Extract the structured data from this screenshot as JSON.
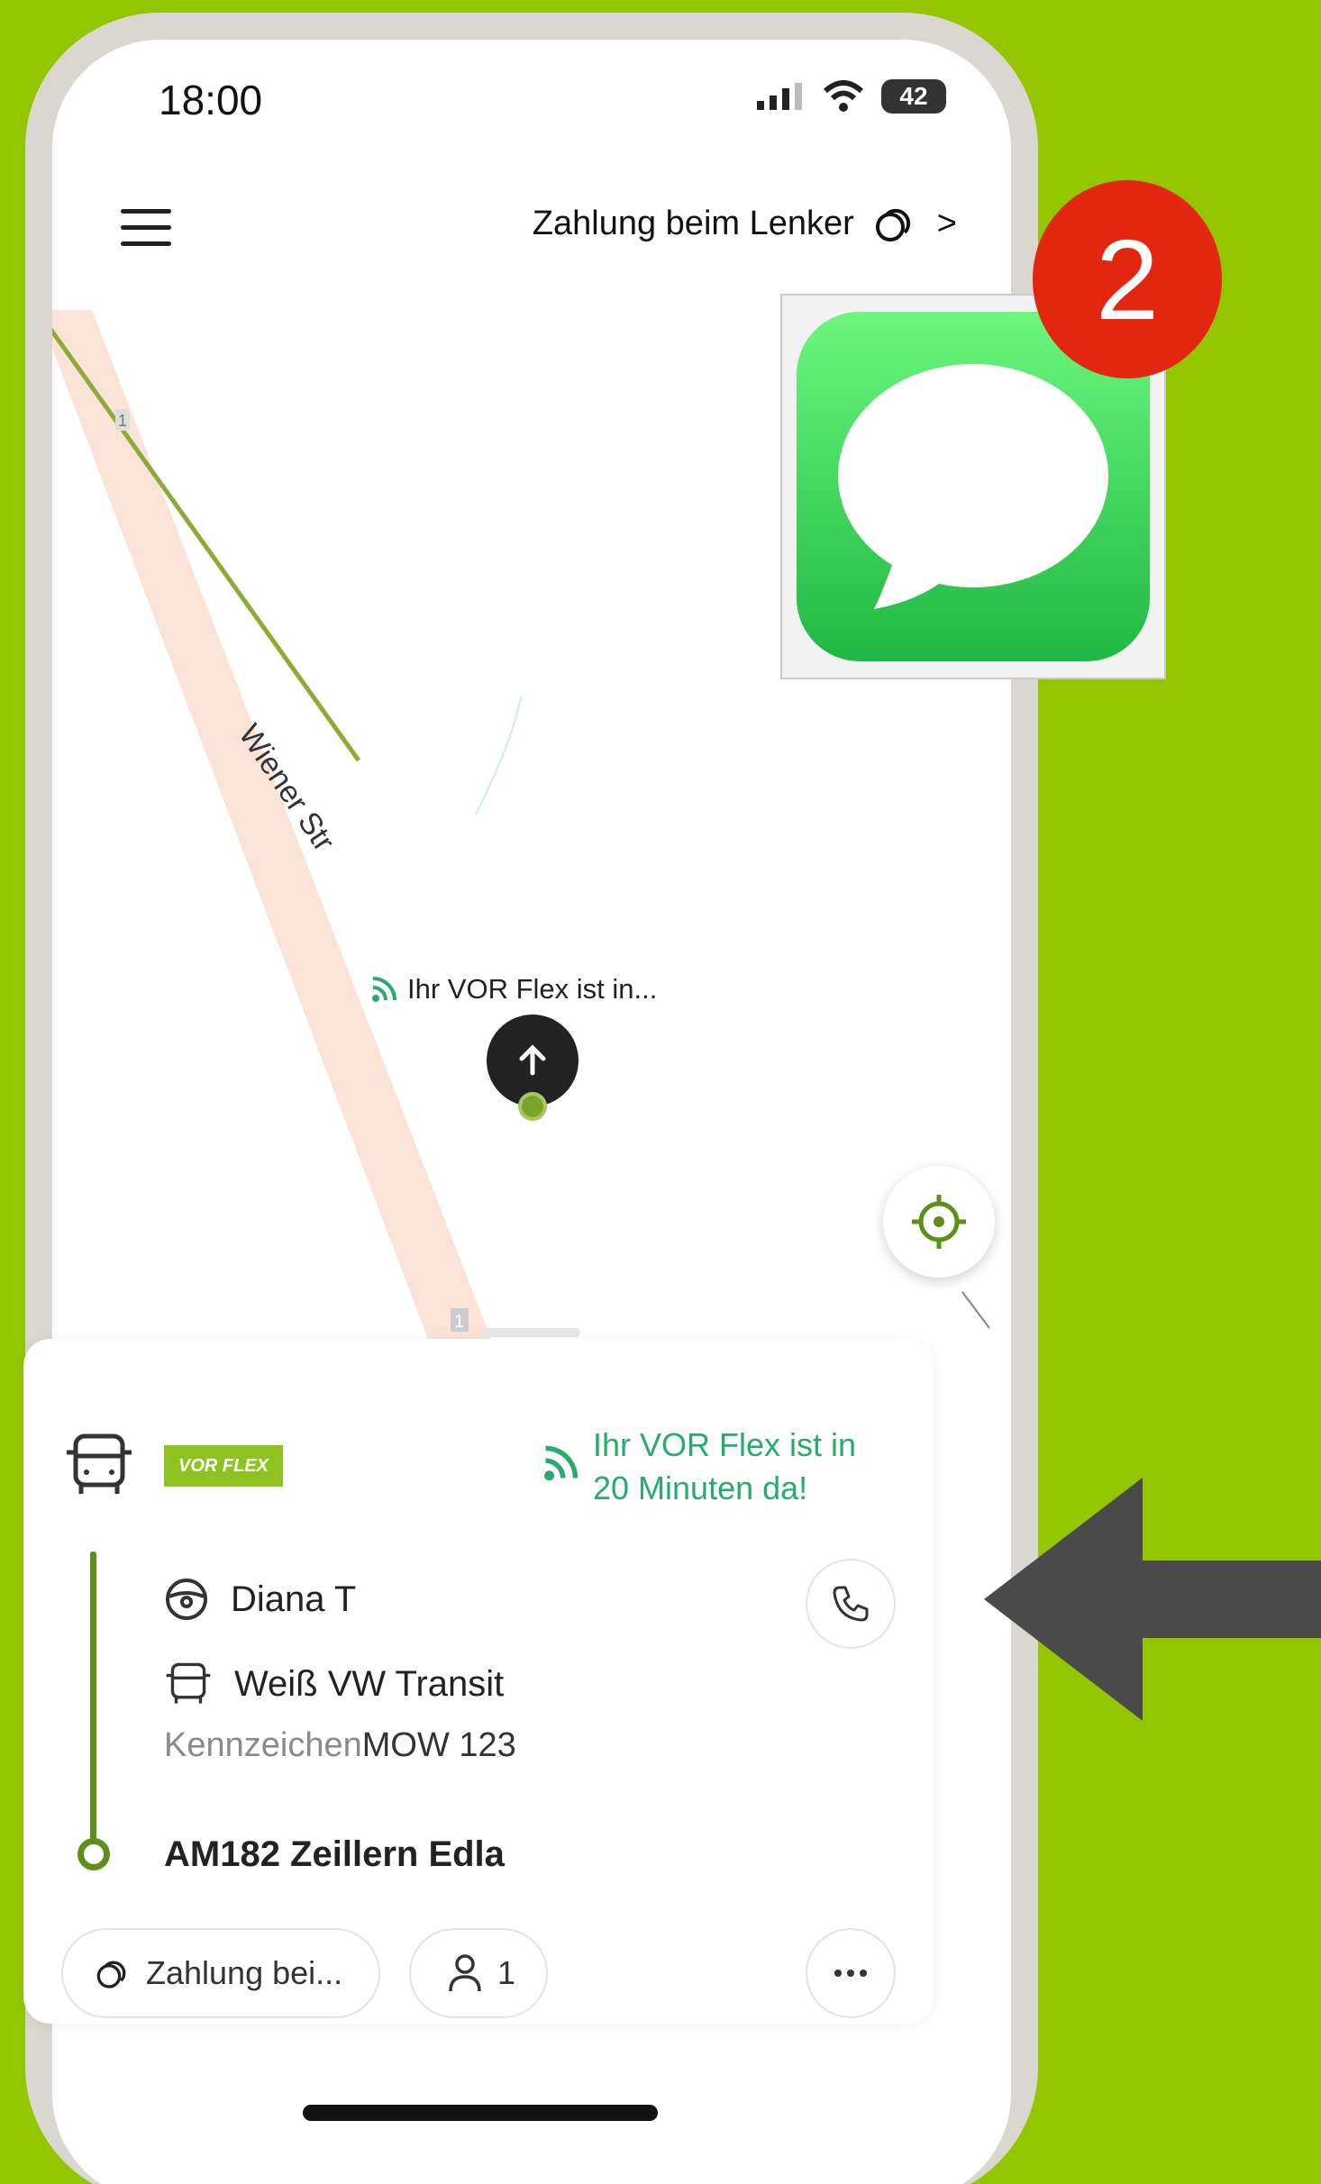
{
  "status_bar": {
    "time": "18:00",
    "battery": "42"
  },
  "header": {
    "payment_label": "Zahlung beim Lenker",
    "chevron": ">"
  },
  "map": {
    "street_name": "Wiener Str",
    "route_marker": "1",
    "vehicle_label": "Ihr VOR Flex ist in..."
  },
  "sheet": {
    "brand_logo": "VOR FLEX",
    "eta_line1": "Ihr VOR Flex ist in",
    "eta_line2": "20 Minuten da!",
    "driver_name": "Diana T",
    "vehicle_desc": "Weiß VW Transit",
    "plate_label": "Kennzeichen",
    "plate_value": "MOW 123",
    "stop_name": "AM182 Zeillern Edla",
    "payment_chip": "Zahlung bei...",
    "passenger_count": "1"
  },
  "overlay": {
    "notification_count": "2",
    "app_icon": "messages-icon"
  },
  "colors": {
    "background": "#94c600",
    "accent_green": "#5e8f1a",
    "eta_green": "#2aab6e",
    "badge_red": "#e3260f"
  }
}
